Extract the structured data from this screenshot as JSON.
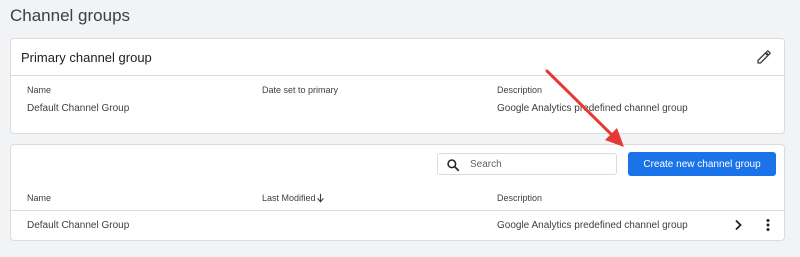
{
  "page": {
    "title": "Channel groups"
  },
  "primary_card": {
    "title": "Primary channel group",
    "columns": {
      "name": "Name",
      "date_set": "Date set to primary",
      "description": "Description"
    },
    "row": {
      "name": "Default Channel Group",
      "date_set": "",
      "description": "Google Analytics predefined channel group"
    }
  },
  "list_card": {
    "search_placeholder": "Search",
    "create_button": "Create new channel group",
    "columns": {
      "name": "Name",
      "last_modified": "Last Modified",
      "description": "Description"
    },
    "rows": [
      {
        "name": "Default Channel Group",
        "last_modified": "",
        "description": "Google Analytics predefined channel group"
      }
    ]
  },
  "colors": {
    "accent": "#1a73e8",
    "arrow": "#e53935",
    "background": "#f1f3f4"
  },
  "icons": {
    "edit": "pencil-icon",
    "search": "search-icon",
    "sort": "arrow-down-icon",
    "row_open": "chevron-right-icon",
    "row_menu": "more-vert-icon"
  }
}
